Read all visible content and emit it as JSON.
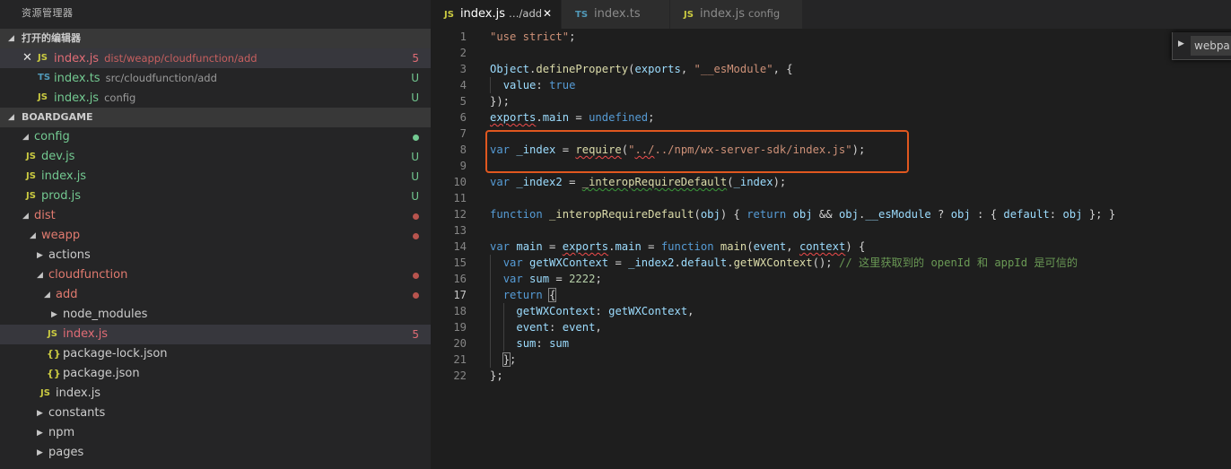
{
  "sidebar": {
    "title": "资源管理器",
    "open_editors": {
      "header": "打开的编辑器",
      "items": [
        {
          "icon": "JS",
          "name": "index.js",
          "desc": "dist/weapp/cloudfunction/add",
          "status": "5"
        },
        {
          "icon": "TS",
          "name": "index.ts",
          "desc": "src/cloudfunction/add",
          "status": "U"
        },
        {
          "icon": "JS",
          "name": "index.js",
          "desc": "config",
          "status": "U"
        }
      ]
    },
    "project": {
      "header": "BOARDGAME",
      "tree": [
        {
          "name": "config"
        },
        {
          "icon": "JS",
          "name": "dev.js",
          "status": "U"
        },
        {
          "icon": "JS",
          "name": "index.js",
          "status": "U"
        },
        {
          "icon": "JS",
          "name": "prod.js",
          "status": "U"
        },
        {
          "name": "dist"
        },
        {
          "name": "weapp"
        },
        {
          "name": "actions"
        },
        {
          "name": "cloudfunction"
        },
        {
          "name": "add"
        },
        {
          "name": "node_modules"
        },
        {
          "icon": "JS",
          "name": "index.js",
          "status": "5"
        },
        {
          "icon": "{}",
          "name": "package-lock.json"
        },
        {
          "icon": "{}",
          "name": "package.json"
        },
        {
          "icon": "JS",
          "name": "index.js"
        },
        {
          "name": "constants"
        },
        {
          "name": "npm"
        },
        {
          "name": "pages"
        }
      ]
    }
  },
  "tabs": [
    {
      "icon": "JS",
      "name": "index.js",
      "desc": "…/add",
      "close": "✕"
    },
    {
      "icon": "TS",
      "name": "index.ts",
      "desc": ""
    },
    {
      "icon": "JS",
      "name": "index.js",
      "desc": "config"
    }
  ],
  "peek": {
    "label": "webpa"
  },
  "code": {
    "line_numbers": [
      "1",
      "2",
      "3",
      "4",
      "5",
      "6",
      "7",
      "8",
      "9",
      "10",
      "11",
      "12",
      "13",
      "14",
      "15",
      "16",
      "17",
      "18",
      "19",
      "20",
      "21",
      "22"
    ],
    "l1_str": "\"use strict\"",
    "l3_a": "Object",
    "l3_b": "defineProperty",
    "l3_c": "exports",
    "l3_d": "\"__esModule\"",
    "l4_a": "value",
    "l4_b": "true",
    "l6_a": "exports",
    "l6_b": "main",
    "l6_c": "undefined",
    "l8_kw": "var",
    "l8_var": "_index",
    "l8_fn": "require",
    "l8_str1": "\"",
    "l8_str2": "../",
    "l8_str3": "../npm/wx-server-sdk/index.js\"",
    "l10_kw": "var",
    "l10_var": "_index2",
    "l10_fn": "_interopRequireDefault",
    "l10_arg": "_index",
    "l12_kw": "function",
    "l12_fn": "_interopRequireDefault",
    "l12_a": "obj",
    "l12_ret": "return",
    "l12_b": "obj",
    "l12_c": "obj",
    "l12_d": "__esModule",
    "l12_e": "obj",
    "l12_f": "default",
    "l12_g": "obj",
    "l14_kw": "var",
    "l14_a": "main",
    "l14_b": "exports",
    "l14_c": "main",
    "l14_fkw": "function",
    "l14_fn": "main",
    "l14_p1": "event",
    "l14_p2": "context",
    "l15_kw": "var",
    "l15_a": "getWXContext",
    "l15_b": "_index2",
    "l15_c": "default",
    "l15_fn": "getWXContext",
    "l15_cm": "// 这里获取到的 openId 和 appId 是可信的",
    "l16_kw": "var",
    "l16_a": "sum",
    "l16_num": "2222",
    "l17_kw": "return",
    "l18_a": "getWXContext",
    "l18_b": "getWXContext",
    "l19_a": "event",
    "l19_b": "event",
    "l20_a": "sum",
    "l20_b": "sum"
  }
}
